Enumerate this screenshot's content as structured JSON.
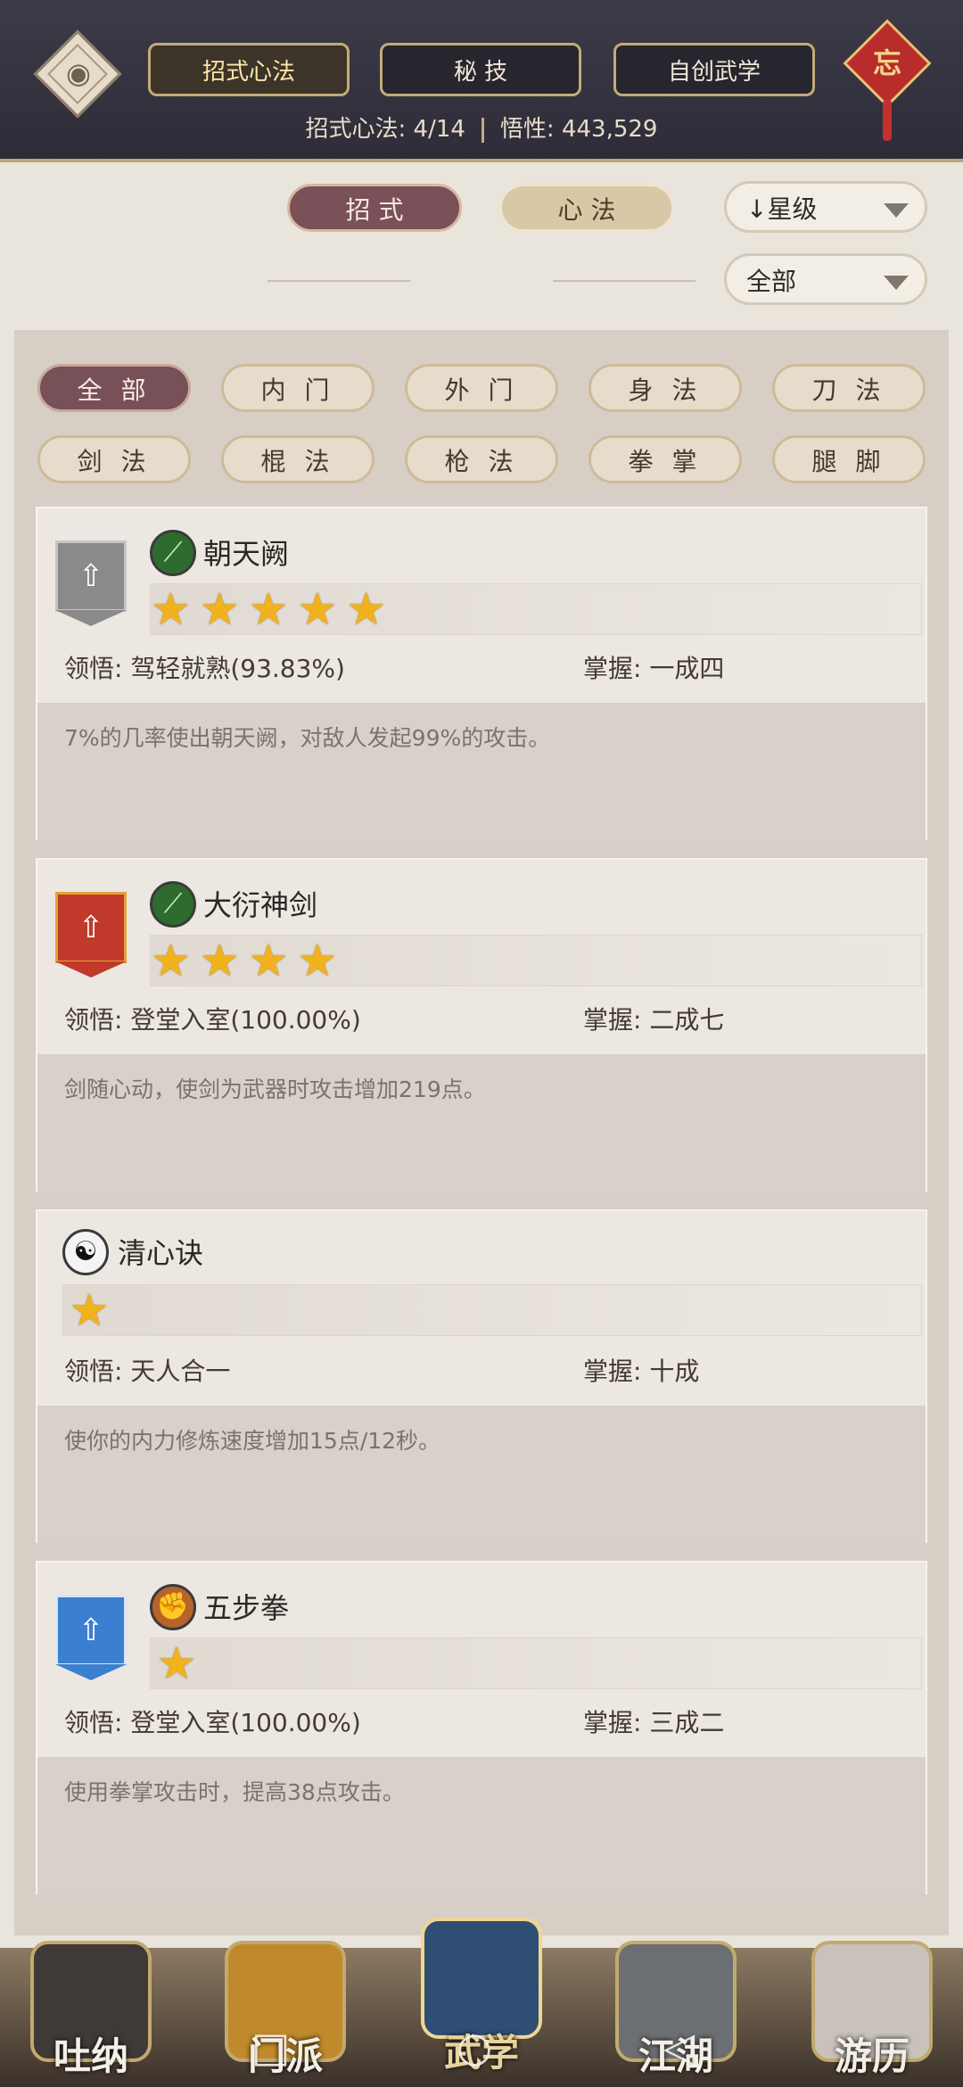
{
  "header": {
    "tabs": [
      "招式心法",
      "秘 技",
      "自创武学"
    ],
    "active_tab": 0,
    "summary_label": "招式心法:",
    "summary_value": "4/14",
    "insight_label": "悟性:",
    "insight_value": "443,529",
    "knot_char": "忘"
  },
  "subtabs": [
    "招 式",
    "心 法"
  ],
  "sort_dropdown": "↓星级",
  "filter_dropdown": "全部",
  "categories": [
    "全 部",
    "内 门",
    "外 门",
    "身 法",
    "刀 法",
    "剑 法",
    "棍 法",
    "枪 法",
    "拳 掌",
    "腿 脚"
  ],
  "cards": [
    {
      "name": "朝天阙",
      "stars": 5,
      "stars_text": "★★★★★",
      "insight_label": "领悟:",
      "insight": "驾轻就熟(93.83%)",
      "mastery_label": "掌握:",
      "mastery": "一成四",
      "desc": "7%的几率使出朝天阙，对敌人发起99%的攻击。",
      "badge_color": "#8a8a8a",
      "icon": "sword-icon"
    },
    {
      "name": "大衍神剑",
      "stars": 4,
      "stars_text": "★★★★",
      "insight_label": "领悟:",
      "insight": "登堂入室(100.00%)",
      "mastery_label": "掌握:",
      "mastery": "二成七",
      "desc": "剑随心动，使剑为武器时攻击增加219点。",
      "badge_color": "#c0392b",
      "icon": "sword-icon"
    },
    {
      "name": "清心诀",
      "stars": 1,
      "stars_text": "★",
      "insight_label": "领悟:",
      "insight": "天人合一",
      "mastery_label": "掌握:",
      "mastery": "十成",
      "desc": "使你的内力修炼速度增加15点/12秒。",
      "badge_color": "",
      "icon": "yin-yang-icon"
    },
    {
      "name": "五步拳",
      "stars": 1,
      "stars_text": "★",
      "insight_label": "领悟:",
      "insight": "登堂入室(100.00%)",
      "mastery_label": "掌握:",
      "mastery": "三成二",
      "desc": "使用拳掌攻击时，提高38点攻击。",
      "badge_color": "#3b7fd1",
      "icon": "fist-icon"
    }
  ],
  "bottom_nav": [
    "吐纳",
    "门派",
    "武学",
    "江湖",
    "游历"
  ],
  "active_nav": 2
}
